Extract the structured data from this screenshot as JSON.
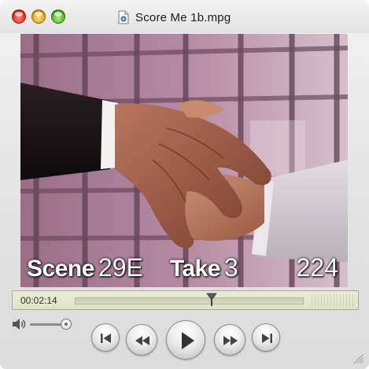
{
  "window": {
    "title": "Score Me 1b.mpg",
    "controls": [
      "close-button",
      "minimize-button",
      "zoom-button"
    ]
  },
  "video": {
    "overlay": {
      "scene_label": "Scene",
      "scene_value": "29E",
      "take_label": "Take",
      "take_value": "3",
      "frame_number": "224"
    }
  },
  "timeline": {
    "current_time": "00:02:14",
    "position_fraction": 0.59
  },
  "volume": {
    "level_fraction": 0.92
  },
  "transport": {
    "buttons": [
      "go-to-start",
      "rewind",
      "play",
      "fast-forward",
      "go-to-end"
    ]
  },
  "colors": {
    "timeline_bg": "#e2e6cc",
    "close": "#e0301c",
    "minimize": "#e5a315",
    "zoom": "#4fb11f"
  }
}
